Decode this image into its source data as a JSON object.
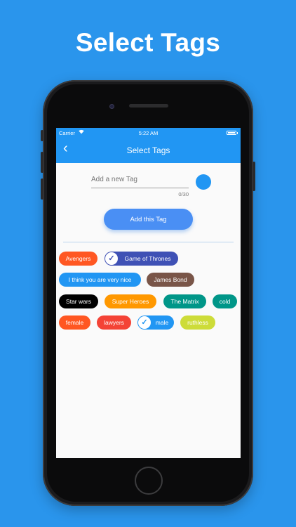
{
  "headline": "Select Tags",
  "status_bar": {
    "carrier": "Carrier",
    "wifi_icon": "wifi-icon",
    "time": "5:22 AM",
    "battery_icon": "battery-icon"
  },
  "app_bar": {
    "back_icon": "chevron-left-icon",
    "back_glyph": "‹",
    "title": "Select Tags"
  },
  "form": {
    "input_placeholder": "Add a new Tag",
    "input_value": "",
    "counter": "0/30",
    "color_swatch": "#2196f3",
    "add_button_label": "Add this Tag"
  },
  "tags": [
    {
      "label": "Avengers",
      "color": "#ff5722",
      "selected": false
    },
    {
      "label": "Game of Thrones",
      "color": "#3f51b5",
      "selected": true
    },
    {
      "label": "I think you are very nice",
      "color": "#2196f3",
      "selected": false
    },
    {
      "label": "James Bond",
      "color": "#795548",
      "selected": false
    },
    {
      "label": "Star wars",
      "color": "#000000",
      "selected": false
    },
    {
      "label": "Super Heroes",
      "color": "#ff9800",
      "selected": false
    },
    {
      "label": "The Matrix",
      "color": "#009688",
      "selected": false
    },
    {
      "label": "cold",
      "color": "#009688",
      "selected": false
    },
    {
      "label": "female",
      "color": "#ff5722",
      "selected": false
    },
    {
      "label": "lawyers",
      "color": "#f44336",
      "selected": false
    },
    {
      "label": "male",
      "color": "#2196f3",
      "selected": true
    },
    {
      "label": "ruthless",
      "color": "#cddc39",
      "selected": false
    }
  ],
  "check_glyph": "✓"
}
